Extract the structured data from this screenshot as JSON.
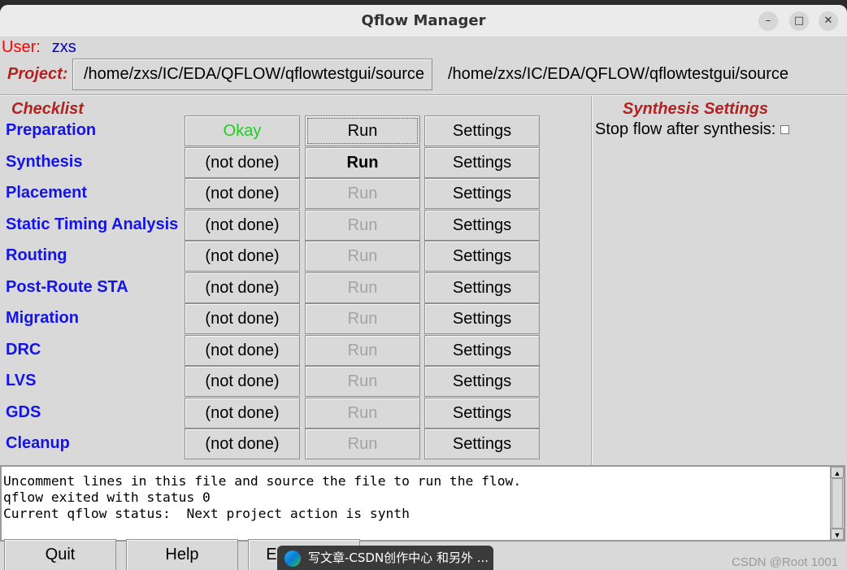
{
  "window": {
    "title": "Qflow Manager",
    "controls": {
      "minimize": "–",
      "maximize": "□",
      "close": "✕"
    }
  },
  "user": {
    "label": "User:",
    "value": "zxs"
  },
  "project": {
    "label": "Project:",
    "button_path": "/home/zxs/IC/EDA/QFLOW/qflowtestgui/source",
    "path": "/home/zxs/IC/EDA/QFLOW/qflowtestgui/source"
  },
  "checklist": {
    "title": "Checklist",
    "steps": [
      {
        "label": "Preparation",
        "status": "Okay",
        "run": "Run",
        "settings": "Settings"
      },
      {
        "label": "Synthesis",
        "status": "(not done)",
        "run": "Run",
        "settings": "Settings"
      },
      {
        "label": "Placement",
        "status": "(not done)",
        "run": "Run",
        "settings": "Settings"
      },
      {
        "label": "Static Timing Analysis",
        "status": "(not done)",
        "run": "Run",
        "settings": "Settings"
      },
      {
        "label": "Routing",
        "status": "(not done)",
        "run": "Run",
        "settings": "Settings"
      },
      {
        "label": "Post-Route STA",
        "status": "(not done)",
        "run": "Run",
        "settings": "Settings"
      },
      {
        "label": "Migration",
        "status": "(not done)",
        "run": "Run",
        "settings": "Settings"
      },
      {
        "label": "DRC",
        "status": "(not done)",
        "run": "Run",
        "settings": "Settings"
      },
      {
        "label": "LVS",
        "status": "(not done)",
        "run": "Run",
        "settings": "Settings"
      },
      {
        "label": "GDS",
        "status": "(not done)",
        "run": "Run",
        "settings": "Settings"
      },
      {
        "label": "Cleanup",
        "status": "(not done)",
        "run": "Run",
        "settings": "Settings"
      }
    ]
  },
  "synthesis_settings": {
    "title": "Synthesis Settings",
    "stop_flow_label": "Stop flow after synthesis:",
    "stop_flow_checked": false
  },
  "console": {
    "lines": [
      "Uncomment lines in this file and source the file to run the flow.",
      "qflow exited with status 0",
      "Current qflow status:  Next project action is synth"
    ]
  },
  "bottom_buttons": {
    "quit": "Quit",
    "help": "Help",
    "edit_layout": "Edit layout"
  },
  "taskbar_popup": "写文章-CSDN创作中心 和另外 ...",
  "watermark": "CSDN @Root 1001"
}
